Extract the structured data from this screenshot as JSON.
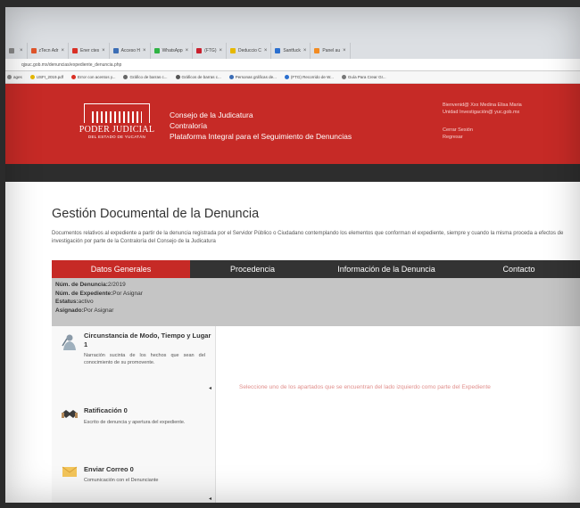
{
  "browser": {
    "tabs": [
      {
        "label": "",
        "color": "#888888"
      },
      {
        "label": "zTecn Adr",
        "color": "#e0552b"
      },
      {
        "label": "Ener ctes",
        "color": "#d93025"
      },
      {
        "label": "Acceso H",
        "color": "#3b6db5"
      },
      {
        "label": "WhatsApp",
        "color": "#2fb344"
      },
      {
        "label": "(FTG)",
        "color": "#c9202d"
      },
      {
        "label": "Deduccio C",
        "color": "#e6b800"
      },
      {
        "label": "Santfuck",
        "color": "#2b6fcf"
      },
      {
        "label": "Panel au",
        "color": "#f28b22"
      }
    ],
    "url": "qjsuc.gob.mx/denuncias/expediente_denuncia.php",
    "bookmarks": [
      {
        "label": "ages",
        "color": "#888888"
      },
      {
        "label": "USFI_2019.pdf",
        "color": "#e6b800"
      },
      {
        "label": "Error con acentos y...",
        "color": "#d93025"
      },
      {
        "label": "Gráfico de barras c...",
        "color": "#666666"
      },
      {
        "label": "Gráficos de barras c...",
        "color": "#555555"
      },
      {
        "label": "Personas gráficas de...",
        "color": "#3b6db5"
      },
      {
        "label": "(FTG) Recorrido de W...",
        "color": "#2b6fcf"
      },
      {
        "label": "Guía Para Crear Gr...",
        "color": "#777777"
      }
    ]
  },
  "header": {
    "logo_name": "PODER JUDICIAL",
    "logo_sub": "DEL ESTADO DE YUCATÁN",
    "line1": "Consejo de la Judicatura",
    "line2": "Contraloría",
    "line3": "Plataforma Integral para el Seguimiento de Denuncias",
    "welcome": "Bienvenid@ Xxx Medina Elisa Maria",
    "unit": "Unidad Investigación@ yuc.gob.mx",
    "logout": "Cerrar Sesión",
    "back": "Regresar"
  },
  "page": {
    "title": "Gestión Documental de la Denuncia",
    "description": "Documentos relativos al expediente a partir de la denuncia registrada por el Servidor Público o Ciudadano contemplando los elementos que conforman el expediente, siempre y cuando la misma proceda a efectos de investigación por parte de la Contraloría del Consejo de la Judicatura"
  },
  "tabs": [
    "Datos Generales",
    "Procedencia",
    "Información de la Denuncia",
    "Contacto"
  ],
  "info": {
    "num_denuncia_label": "Núm. de Denuncia:",
    "num_denuncia_value": "2/2019",
    "num_expediente_label": "Núm. de Expediente:",
    "num_expediente_value": "Por Asignar",
    "estatus_label": "Estatus:",
    "estatus_value": "activo",
    "asignado_label": "Asignado:",
    "asignado_value": "Por Asignar"
  },
  "sections": [
    {
      "title": "Circunstancia de Modo, Tiempo y Lugar 1",
      "body": "Narración sucinta de los hechos que sean del conocimiento de su promovente."
    },
    {
      "title": "Ratificación 0",
      "body": "Escrito de denuncia y apertura del expediente."
    },
    {
      "title": "Enviar Correo 0",
      "body": "Comunicación con el Denunciante"
    }
  ],
  "message": "Seleccione uno de los apartados que se encuentran del lado izquierdo como parte del Expediente",
  "colors": {
    "primary": "#c62a26",
    "dark": "#333333"
  }
}
